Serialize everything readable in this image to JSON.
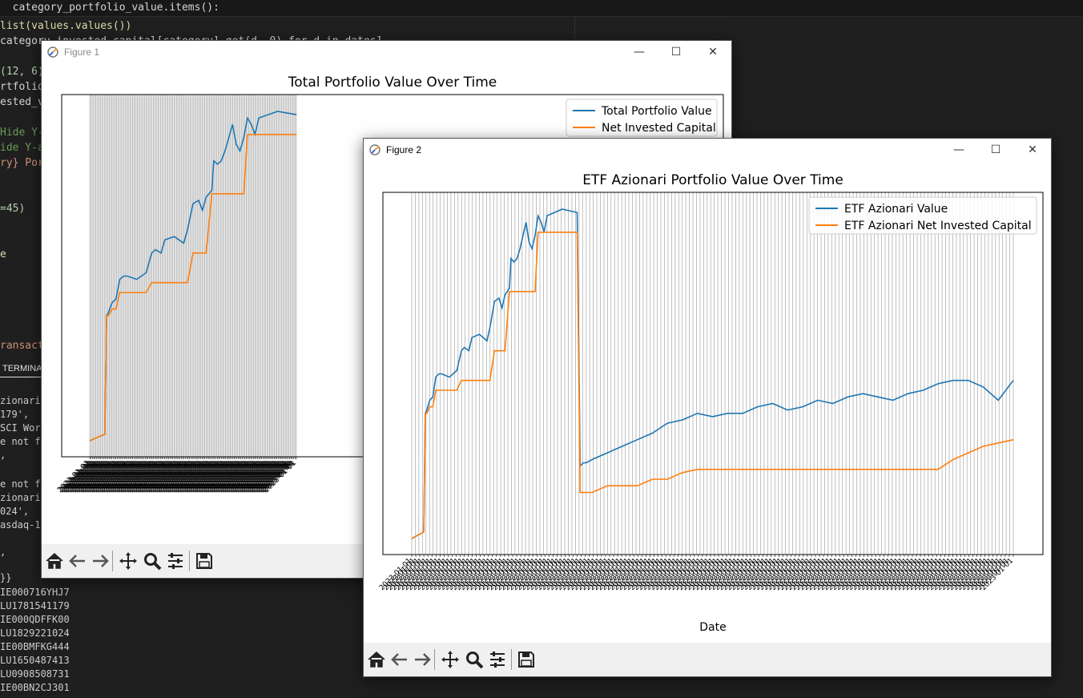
{
  "editor": {
    "code_lines": [
      {
        "text": "  category_portfolio_value.items():"
      },
      {
        "text": "list(values.values())"
      },
      {
        "text": "category_invested_capital[category].get(d, 0) for d in dates]"
      },
      {
        "text": "(12, 6)"
      },
      {
        "text": "rtfolio_"
      },
      {
        "text": "ested_v"
      },
      {
        "text": "Hide Y-"
      },
      {
        "text": "ide Y-a"
      },
      {
        "text": "ry} Por"
      },
      {
        "text": "=45)"
      },
      {
        "text": "e"
      },
      {
        "text": "ransact"
      }
    ],
    "terminal_tab": "TERMINAL",
    "terminal_lines": [
      "zionari\"",
      "179',",
      "SCI Worl",
      "e not fo",
      ",",
      "e not fo",
      "zionari\"",
      "024',",
      "asdaq-10",
      ",",
      "}}",
      "IE000716YHJ7",
      "LU1781541179",
      "IE000QDFFK00",
      "LU1829221024",
      "IE00BMFKG444",
      "LU1650487413",
      "LU0908508731",
      "IE00BN2CJ301"
    ]
  },
  "figure1": {
    "window_title": "Figure 1",
    "minimize_icon": "minimize-icon",
    "maximize_icon": "maximize-icon",
    "close_icon": "close-icon",
    "title": "Total Portfolio Value Over Time",
    "legend": [
      "Total Portfolio Value",
      "Net Invested Capital"
    ],
    "colors": {
      "value": "#1f77b4",
      "capital": "#ff7f0e"
    }
  },
  "figure2": {
    "window_title": "Figure 2",
    "title": "ETF Azionari Portfolio Value Over Time",
    "xlabel": "Date",
    "legend": [
      "ETF Azionari Value",
      "ETF Azionari Net Invested Capital"
    ],
    "colors": {
      "value": "#1f77b4",
      "capital": "#ff7f0e"
    }
  },
  "toolbar_icons": [
    "home-icon",
    "back-icon",
    "forward-icon",
    "pan-icon",
    "zoom-icon",
    "configure-subplots-icon",
    "save-icon"
  ],
  "chart_data": [
    {
      "type": "line",
      "title": "Total Portfolio Value Over Time",
      "xlabel": "",
      "ylabel": "",
      "y_ticks_hidden": true,
      "x_ticks": "dense rotated date labels (unreadable)",
      "grid": "vertical lines at every date",
      "legend_placement": "top-right",
      "x_index": [
        0,
        8,
        9,
        10,
        12,
        14,
        16,
        18,
        20,
        25,
        30,
        33,
        35,
        38,
        40,
        45,
        50,
        52,
        55,
        58,
        60,
        62,
        65,
        66,
        68,
        70,
        72,
        74,
        75,
        76,
        78,
        80,
        82,
        84,
        85,
        86,
        88,
        90,
        95,
        100,
        110
      ],
      "series": [
        {
          "name": "Total Portfolio Value",
          "values": [
            0,
            0.02,
            0.38,
            0.39,
            0.42,
            0.43,
            0.49,
            0.5,
            0.5,
            0.49,
            0.51,
            0.57,
            0.58,
            0.57,
            0.61,
            0.62,
            0.6,
            0.64,
            0.72,
            0.73,
            0.7,
            0.74,
            0.76,
            0.85,
            0.84,
            0.85,
            0.88,
            0.92,
            0.94,
            0.96,
            0.9,
            0.88,
            0.92,
            0.98,
            0.97,
            0.96,
            0.93,
            0.98,
            0.99,
            1.0,
            0.99
          ]
        },
        {
          "name": "Net Invested Capital",
          "values": [
            0,
            0.02,
            0.38,
            0.38,
            0.4,
            0.4,
            0.45,
            0.45,
            0.45,
            0.45,
            0.45,
            0.48,
            0.48,
            0.48,
            0.48,
            0.48,
            0.48,
            0.48,
            0.57,
            0.57,
            0.57,
            0.57,
            0.75,
            0.75,
            0.75,
            0.75,
            0.75,
            0.75,
            0.75,
            0.75,
            0.75,
            0.75,
            0.75,
            0.93,
            0.93,
            0.93,
            0.93,
            0.93,
            0.93,
            0.93,
            0.93
          ]
        }
      ]
    },
    {
      "type": "line",
      "title": "ETF Azionari Portfolio Value Over Time",
      "xlabel": "Date",
      "ylabel": "",
      "y_ticks_hidden": true,
      "x_ticks": "dense rotated date labels (unreadable)",
      "grid": "vertical lines at every date",
      "legend_placement": "top-right",
      "x_index": [
        0,
        8,
        9,
        10,
        12,
        14,
        16,
        18,
        20,
        25,
        30,
        33,
        35,
        38,
        40,
        45,
        50,
        52,
        55,
        58,
        60,
        62,
        65,
        66,
        68,
        70,
        72,
        74,
        75,
        76,
        78,
        80,
        82,
        84,
        85,
        86,
        88,
        90,
        95,
        100,
        110,
        112,
        114,
        116,
        120,
        130,
        140,
        150,
        160,
        170,
        180,
        190,
        200,
        210,
        220,
        230,
        240,
        250,
        260,
        270,
        280,
        290,
        300,
        310,
        320,
        330,
        340,
        350,
        360,
        370,
        380,
        390,
        400
      ],
      "series": [
        {
          "name": "ETF Azionari Value",
          "values": [
            0,
            0.02,
            0.38,
            0.39,
            0.42,
            0.43,
            0.49,
            0.5,
            0.5,
            0.49,
            0.51,
            0.57,
            0.58,
            0.57,
            0.61,
            0.62,
            0.6,
            0.64,
            0.72,
            0.73,
            0.7,
            0.74,
            0.76,
            0.85,
            0.84,
            0.85,
            0.88,
            0.92,
            0.94,
            0.96,
            0.9,
            0.88,
            0.92,
            0.98,
            0.97,
            0.96,
            0.93,
            0.98,
            0.99,
            1.0,
            0.99,
            0.22,
            0.23,
            0.23,
            0.24,
            0.26,
            0.28,
            0.3,
            0.32,
            0.35,
            0.36,
            0.38,
            0.37,
            0.38,
            0.38,
            0.4,
            0.41,
            0.39,
            0.4,
            0.42,
            0.41,
            0.43,
            0.44,
            0.43,
            0.42,
            0.44,
            0.45,
            0.47,
            0.48,
            0.48,
            0.46,
            0.42,
            0.48
          ]
        },
        {
          "name": "ETF Azionari Net Invested Capital",
          "values": [
            0,
            0.02,
            0.38,
            0.38,
            0.4,
            0.4,
            0.45,
            0.45,
            0.45,
            0.45,
            0.45,
            0.48,
            0.48,
            0.48,
            0.48,
            0.48,
            0.48,
            0.48,
            0.57,
            0.57,
            0.57,
            0.57,
            0.75,
            0.75,
            0.75,
            0.75,
            0.75,
            0.75,
            0.75,
            0.75,
            0.75,
            0.75,
            0.75,
            0.93,
            0.93,
            0.93,
            0.93,
            0.93,
            0.93,
            0.93,
            0.93,
            0.14,
            0.14,
            0.14,
            0.14,
            0.16,
            0.16,
            0.16,
            0.18,
            0.18,
            0.2,
            0.21,
            0.21,
            0.21,
            0.21,
            0.21,
            0.21,
            0.21,
            0.21,
            0.21,
            0.21,
            0.21,
            0.21,
            0.21,
            0.21,
            0.21,
            0.21,
            0.21,
            0.24,
            0.26,
            0.28,
            0.29,
            0.3
          ]
        }
      ]
    }
  ]
}
